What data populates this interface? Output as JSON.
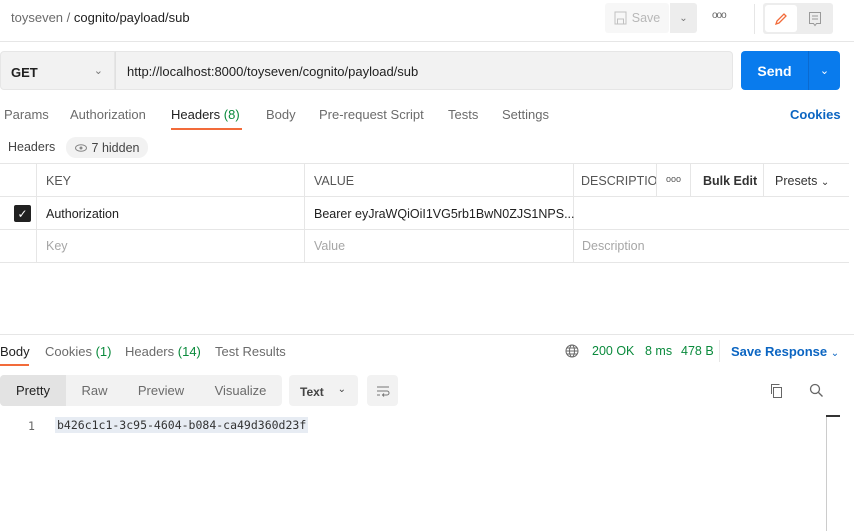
{
  "breadcrumb": {
    "workspace": "toyseven",
    "separator": "/",
    "request": "cognito/payload/sub"
  },
  "toolbar": {
    "save_label": "Save",
    "more_label": "ooo"
  },
  "request": {
    "method": "GET",
    "url": "http://localhost:8000/toyseven/cognito/payload/sub",
    "send_label": "Send"
  },
  "request_tabs": [
    {
      "label": "Params"
    },
    {
      "label": "Authorization"
    },
    {
      "label": "Headers",
      "count": "(8)"
    },
    {
      "label": "Body"
    },
    {
      "label": "Pre-request Script"
    },
    {
      "label": "Tests"
    },
    {
      "label": "Settings"
    }
  ],
  "cookies_label": "Cookies",
  "headers_section": {
    "label": "Headers",
    "hidden_label": "7 hidden"
  },
  "table": {
    "columns": {
      "key": "KEY",
      "value": "VALUE",
      "description": "DESCRIPTIO",
      "more": "ooo",
      "bulk_edit": "Bulk Edit",
      "presets": "Presets"
    },
    "rows": [
      {
        "checked": true,
        "key": "Authorization",
        "value": "Bearer eyJraWQiOiI1VG5rb1BwN0ZJS1NPS...",
        "description": ""
      }
    ],
    "placeholders": {
      "key": "Key",
      "value": "Value",
      "description": "Description"
    }
  },
  "response_tabs": [
    {
      "label": "Body"
    },
    {
      "label": "Cookies",
      "count": "(1)"
    },
    {
      "label": "Headers",
      "count": "(14)"
    },
    {
      "label": "Test Results"
    }
  ],
  "status": {
    "code": "200 OK",
    "time": "8 ms",
    "size": "478 B",
    "save_response": "Save Response"
  },
  "view_modes": [
    "Pretty",
    "Raw",
    "Preview",
    "Visualize"
  ],
  "format": "Text",
  "response_body": {
    "line_number": "1",
    "text": "b426c1c1-3c95-4604-b084-ca49d360d23f"
  },
  "colors": {
    "accent": "#f26b3a",
    "send": "#097bed",
    "link": "#0b65c2",
    "status": "#0a8a3c"
  }
}
